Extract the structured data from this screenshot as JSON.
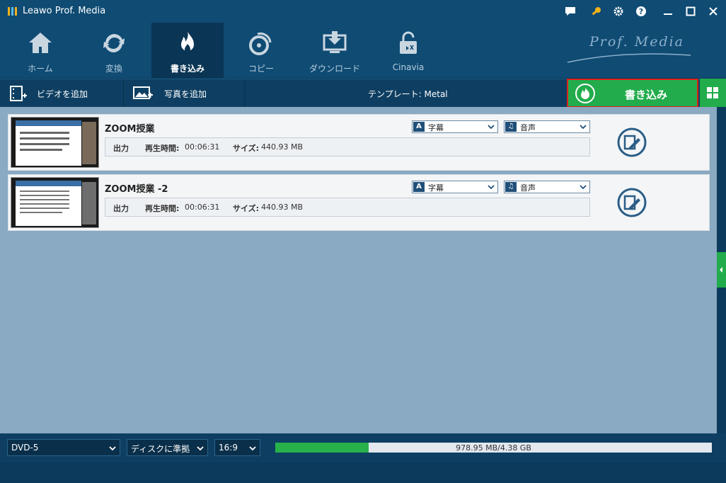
{
  "window": {
    "title": "Leawo Prof. Media"
  },
  "nav": {
    "tabs": [
      {
        "label": "ホーム",
        "icon": "home-icon"
      },
      {
        "label": "変換",
        "icon": "convert-icon"
      },
      {
        "label": "書き込み",
        "icon": "burn-icon",
        "active": true
      },
      {
        "label": "コピー",
        "icon": "copy-disc-icon"
      },
      {
        "label": "ダウンロード",
        "icon": "download-icon"
      },
      {
        "label": "Cinavia",
        "icon": "cinavia-lock-icon"
      }
    ],
    "brand": "Prof. Media"
  },
  "toolbar": {
    "add_video": "ビデオを追加",
    "add_photo": "写真を追加",
    "template": "テンプレート: Metal",
    "burn": "書き込み"
  },
  "items": [
    {
      "title": "ZOOM授業",
      "output_label": "出力",
      "duration_label": "再生時間:",
      "duration": "00:06:31",
      "size_label": "サイズ:",
      "size": "440.93 MB",
      "subtitle": "字幕",
      "audio": "音声"
    },
    {
      "title": "ZOOM授業 -2",
      "output_label": "出力",
      "duration_label": "再生時間:",
      "duration": "00:06:31",
      "size_label": "サイズ:",
      "size": "440.93 MB",
      "subtitle": "字幕",
      "audio": "音声"
    }
  ],
  "bottom": {
    "disc_type": "DVD-5",
    "quality": "ディスクに準拠",
    "aspect": "16:9",
    "capacity": "978.95 MB/4.38 GB",
    "used_fraction": 0.2133
  },
  "colors": {
    "accent_green": "#22ac4c",
    "highlight_red": "#e0201c",
    "nav_bg": "#0f4b73"
  }
}
